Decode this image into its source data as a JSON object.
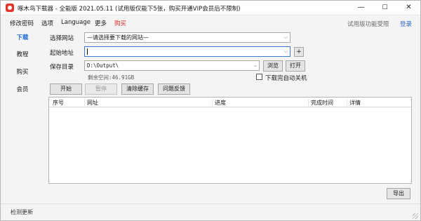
{
  "window": {
    "title": "啄木鸟下载器 - 全能版 2021.05.11 (试用版仅能下5张，购买开通VIP会员后不限制)",
    "controls": {
      "minimize": "—",
      "maximize": "☐",
      "close": "✕"
    }
  },
  "menu": {
    "items": [
      "修改密码",
      "选项",
      "Language",
      "更多",
      "购买"
    ],
    "trial_link": "试用版功能受限",
    "login_link": "登录"
  },
  "sidebar": {
    "items": [
      "下载",
      "教程",
      "购买",
      "会员"
    ],
    "active": "下载"
  },
  "form": {
    "site_label": "选择网站",
    "site_value": "—请选择要下载的网站—",
    "start_label": "起始地址",
    "start_value": "",
    "add_button": "+",
    "dir_label": "保存目录",
    "dir_value": "D:\\Output\\",
    "browse_button": "浏览",
    "open_button": "打开",
    "free_space": "剩余空间:46.91GB",
    "shutdown_label": "下载完自动关机",
    "shutdown_checked": false
  },
  "actions": {
    "start": "开始",
    "pause": "暂停",
    "clear_cache": "清除缓存",
    "feedback": "问题反馈"
  },
  "table": {
    "columns": [
      "序号",
      "网址",
      "进度",
      "完成时间",
      "详情"
    ],
    "rows": []
  },
  "export_button": "导出",
  "status": {
    "text": "检测更新"
  },
  "colors": {
    "accent": "#1f6fd1",
    "purchase": "#d93025",
    "app_icon": "#e4342a",
    "login": "#2b66c9"
  },
  "icons": {
    "app": "woodpecker-app-icon",
    "dropdown": "chevron-down-icon"
  }
}
